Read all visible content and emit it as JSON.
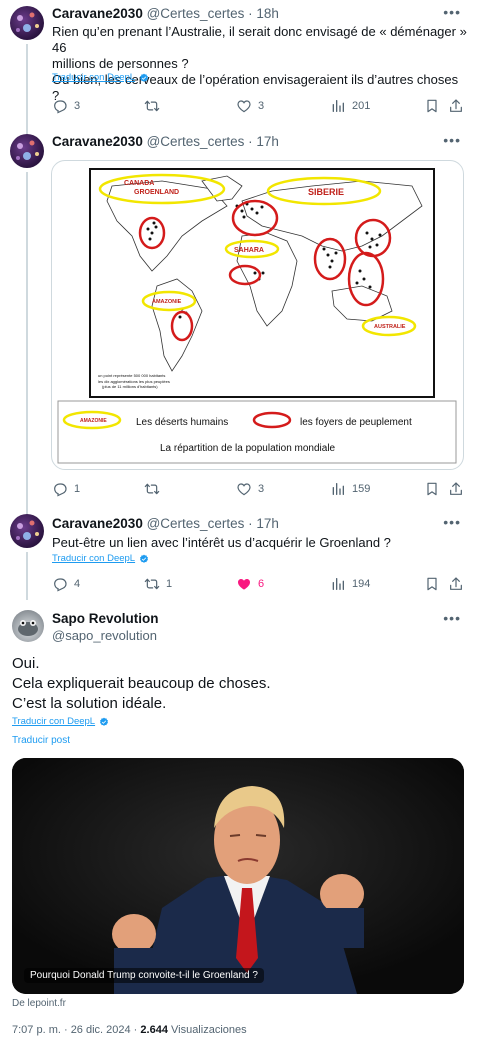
{
  "tweet1": {
    "name": "Caravane2030",
    "handle": "@Certes_certes · 18h",
    "line1": "Rien qu’en prenant l’Australie, il serait donc envisagé de « déménager » 46",
    "line2": "millions de personnes ?",
    "line3": "Ou bien, les cerveaux de l’opération envisageraient ils d’autres choses ?",
    "translate": "Traducir con DeepL",
    "replies": "3",
    "retweets": "",
    "likes": "3",
    "views": "201"
  },
  "tweet2": {
    "name": "Caravane2030",
    "handle": "@Certes_certes · 17h",
    "replies": "1",
    "retweets": "",
    "likes": "3",
    "views": "159",
    "map": {
      "labels": {
        "canada": "CANADA",
        "groenland": "GROENLAND",
        "siberie": "SIBERIE",
        "sahara": "SAHARA",
        "amazonie": "AMAZONIE",
        "australie": "AUSTRALIE"
      },
      "map_legend_line1": "un point représente 500 000 habitants",
      "map_legend_line2": "les dix agglomérations les plus peuplées",
      "map_legend_line3": "(plus de 11 millions d'habitants)",
      "legend_desert": "Les déserts humains",
      "legend_foyers": "les foyers de peuplement",
      "legend_amazonie": "AMAZONIE",
      "caption": "La répartition de la population mondiale"
    }
  },
  "tweet3": {
    "name": "Caravane2030",
    "handle": "@Certes_certes · 17h",
    "text": "Peut-être un lien avec l’intérêt us d’acquérir le Groenland ?",
    "translate": "Traducir con DeepL",
    "replies": "4",
    "retweets": "1",
    "likes": "6",
    "views": "194"
  },
  "main": {
    "name": "Sapo Revolution",
    "handle": "@sapo_revolution",
    "line1": "Oui.",
    "line2": "Cela expliquerait beaucoup de choses.",
    "line3": "C’est la solution idéale.",
    "translate_deepl": "Traducir con DeepL",
    "translate_post": "Traducir post",
    "card_title": "Pourquoi Donald Trump convoite-t-il le Groenland ?",
    "card_source": "De lepoint.fr",
    "timestamp": "7:07 p. m. · 26 dic. 2024 · ",
    "views_count": "2.644",
    "views_label": " Visualizaciones"
  },
  "colors": {
    "accent": "#1d9bf0",
    "like": "#f91880",
    "muted": "#536471",
    "line": "#cfd9de"
  },
  "icons": [
    "reply-icon",
    "retweet-icon",
    "heart-icon",
    "views-icon",
    "bookmark-icon",
    "share-icon",
    "more-icon",
    "verified-badge-icon"
  ]
}
